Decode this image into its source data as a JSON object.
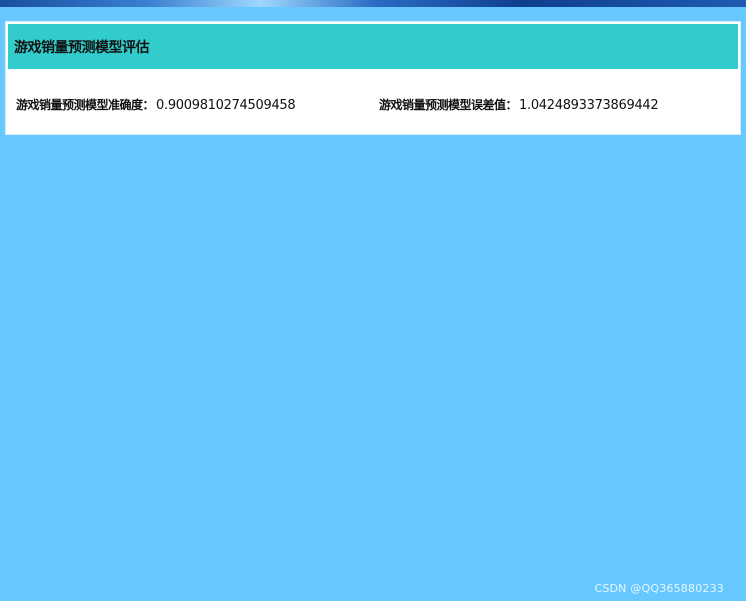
{
  "panel": {
    "title": "游戏销量预测模型评估"
  },
  "metrics": {
    "accuracy": {
      "label": "游戏销量预测模型准确度：",
      "value": "0.9009810274509458"
    },
    "error": {
      "label": "游戏销量预测模型误差值：",
      "value": "1.0424893373869442"
    }
  },
  "watermark": {
    "text": "CSDN @QQ365880233"
  },
  "colors": {
    "page_background": "#66c8ff",
    "header_background": "#33cccc",
    "panel_background": "#ffffff"
  }
}
